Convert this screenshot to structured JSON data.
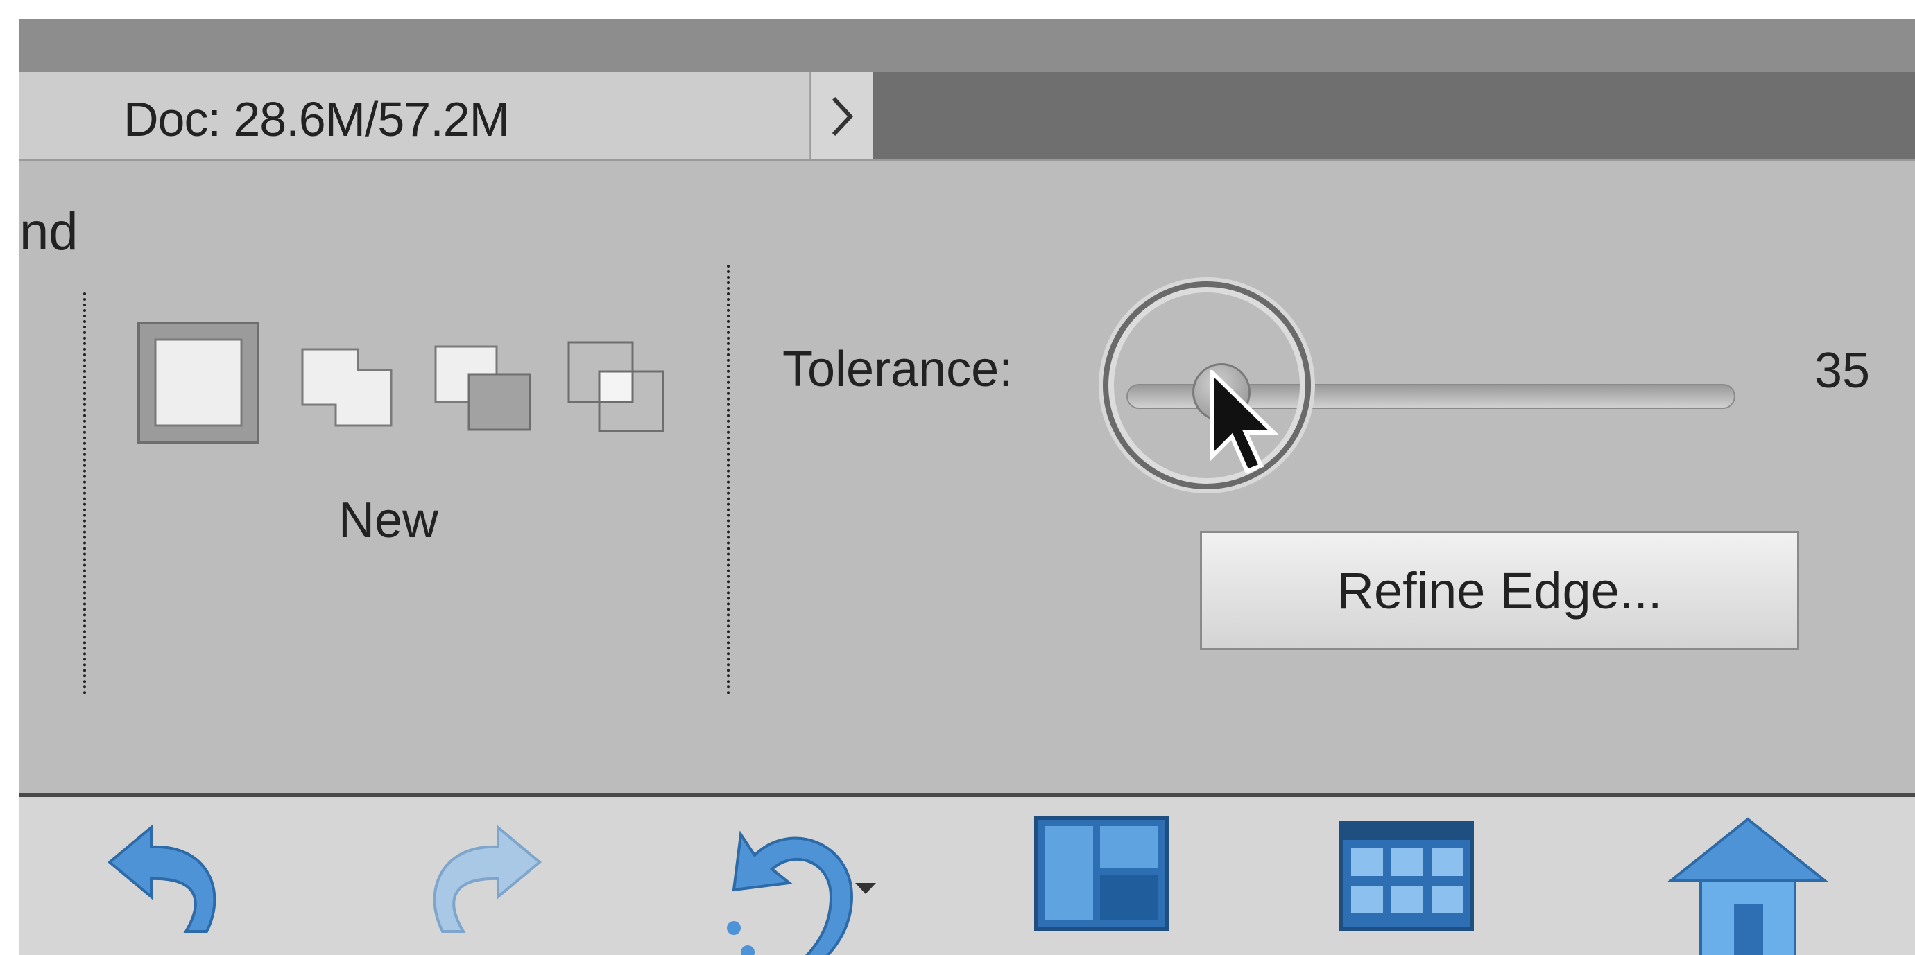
{
  "statusbar": {
    "doc_size": "Doc: 28.6M/57.2M",
    "expand_icon": "chevron-right-icon"
  },
  "options_bar": {
    "cut_label": "nd",
    "selection_modes": [
      {
        "name": "new-selection",
        "selected": true
      },
      {
        "name": "add-to-selection",
        "selected": false
      },
      {
        "name": "subtract-from-selection",
        "selected": false
      },
      {
        "name": "intersect-with-selection",
        "selected": false
      }
    ],
    "mode_label": "New",
    "tolerance": {
      "label": "Tolerance:",
      "value": "35",
      "level_fraction": 0.12
    },
    "refine_edge_label": "Refine Edge..."
  },
  "taskbar": {
    "icons": [
      "undo-icon",
      "redo-icon",
      "rotate-icon",
      "layout-icon",
      "organizer-icon",
      "home-icon"
    ]
  },
  "colors": {
    "panel_bg": "#bcbcbc",
    "status_bg": "#cdcdcd",
    "icon_blue": "#3f86cc"
  }
}
